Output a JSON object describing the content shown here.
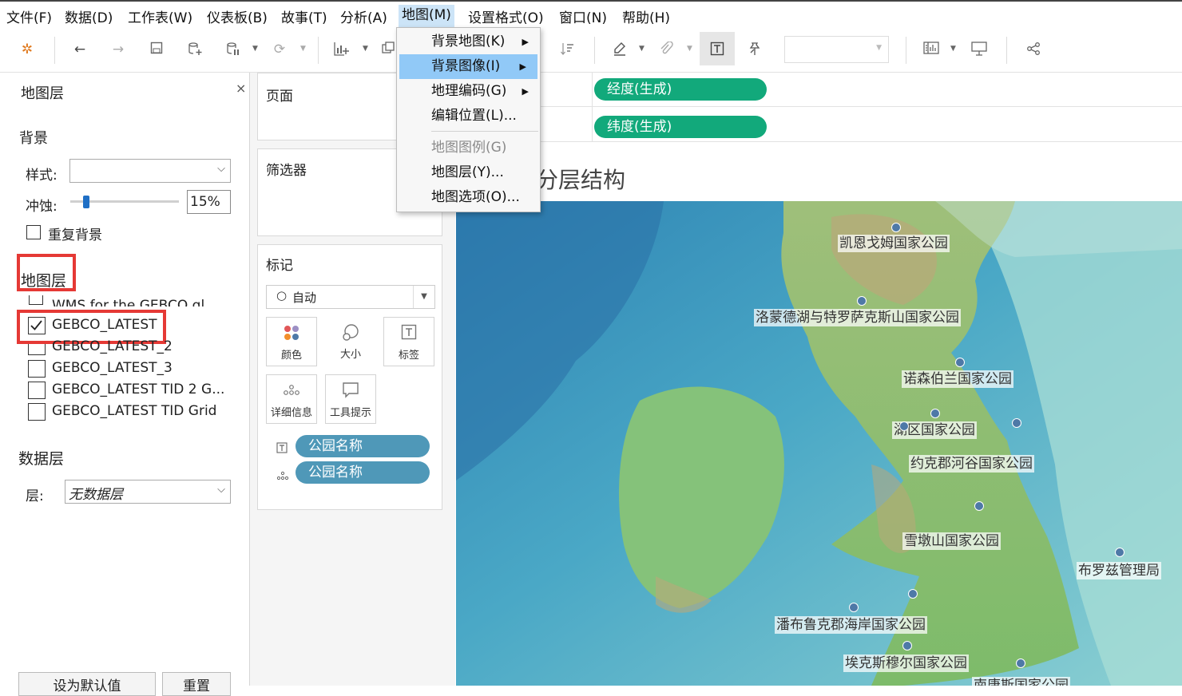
{
  "menubar": {
    "items": [
      {
        "label": "文件(F)"
      },
      {
        "label": "数据(D)"
      },
      {
        "label": "工作表(W)"
      },
      {
        "label": "仪表板(B)"
      },
      {
        "label": "故事(T)"
      },
      {
        "label": "分析(A)"
      },
      {
        "label": "地图(M)"
      },
      {
        "label": "设置格式(O)"
      },
      {
        "label": "窗口(N)"
      },
      {
        "label": "帮助(H)"
      }
    ]
  },
  "map_menu": {
    "items": [
      {
        "label": "背景地图(K)",
        "submenu": "▶"
      },
      {
        "label": "背景图像(I)",
        "submenu": "▶"
      },
      {
        "label": "地理编码(G)",
        "submenu": "▶"
      },
      {
        "label": "编辑位置(L)..."
      },
      {
        "label": "地图图例(G)"
      },
      {
        "label": "地图层(Y)..."
      },
      {
        "label": "地图选项(O)..."
      }
    ]
  },
  "left_panel": {
    "title": "地图层",
    "close": "×",
    "background_section": "背景",
    "style_label": "样式:",
    "style_value": "",
    "washout_label": "冲蚀:",
    "washout_value": "15%",
    "washout_fraction": 0.15,
    "repeat_label": "重复背景",
    "map_layers_section": "地图层",
    "layers": [
      {
        "label": "WMS for the GEBCO gl...",
        "checked": false
      },
      {
        "label": "GEBCO_LATEST",
        "checked": true
      },
      {
        "label": "GEBCO_LATEST_2",
        "checked": false
      },
      {
        "label": "GEBCO_LATEST_3",
        "checked": false
      },
      {
        "label": "GEBCO_LATEST TID 2 G...",
        "checked": false
      },
      {
        "label": "GEBCO_LATEST TID Grid",
        "checked": false
      }
    ],
    "data_layer_section": "数据层",
    "layer_label": "层:",
    "layer_value": "无数据层",
    "set_default_button": "设为默认值",
    "reset_button": "重置"
  },
  "shelves": {
    "pages_title": "页面",
    "filters_title": "筛选器",
    "marks_title": "标记",
    "marks_type": "自动",
    "mark_buttons": [
      {
        "label": "颜色",
        "icon": "color-dots-icon"
      },
      {
        "label": "大小",
        "icon": "size-icon"
      },
      {
        "label": "标签",
        "icon": "label-icon"
      },
      {
        "label": "详细信息",
        "icon": "detail-icon"
      },
      {
        "label": "工具提示",
        "icon": "tooltip-icon"
      }
    ],
    "mark_fields": [
      {
        "label": "公园名称",
        "icon": "label-icon"
      },
      {
        "label": "公园名称",
        "icon": "detail-icon"
      }
    ],
    "columns_field": "经度(生成)",
    "rows_field": "纬度(生成)"
  },
  "view": {
    "title_partial": "分层结构"
  },
  "parks": [
    {
      "name": "凯恩戈姆国家公园"
    },
    {
      "name": "洛蒙德湖与特罗萨克斯山国家公园"
    },
    {
      "name": "诺森伯兰国家公园"
    },
    {
      "name": "湖区国家公园"
    },
    {
      "name": "约克郡河谷国家公园"
    },
    {
      "name": "雪墩山国家公园"
    },
    {
      "name": "布罗兹管理局"
    },
    {
      "name": "潘布鲁克郡海岸国家公园"
    },
    {
      "name": "埃克斯穆尔国家公园"
    },
    {
      "name": "南唐斯国家公园"
    }
  ],
  "colors": {
    "pill_green": "#12a97b",
    "pill_blue": "#4f98b8",
    "highlight_red": "#e53935",
    "menu_highlight": "#91c9f7",
    "mark_dot": "#4e79a7"
  }
}
